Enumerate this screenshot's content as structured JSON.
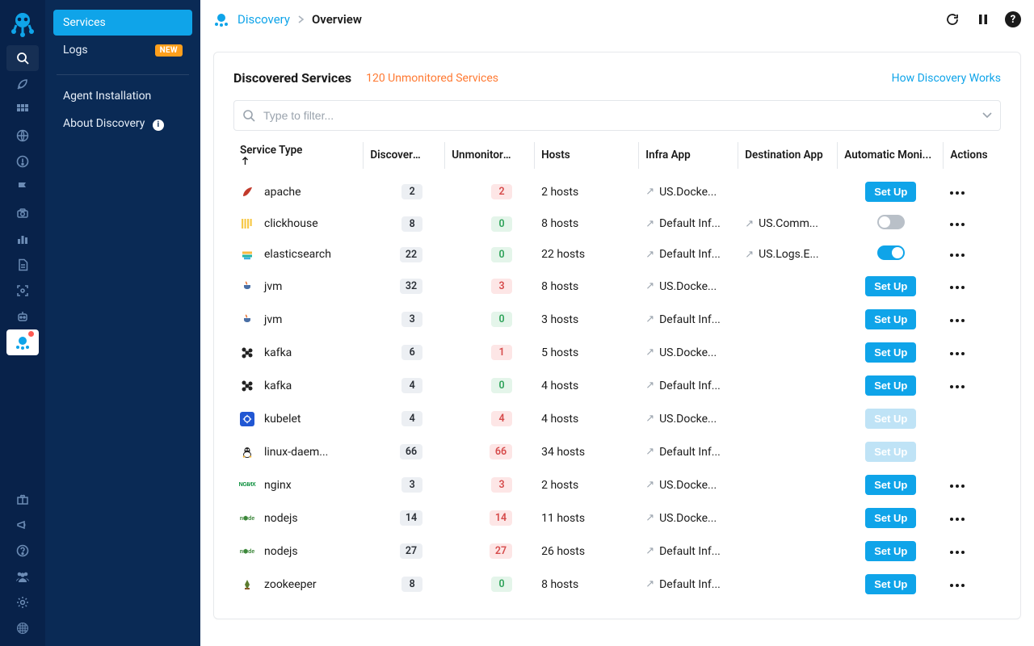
{
  "breadcrumb": {
    "section": "Discovery",
    "page": "Overview"
  },
  "sidebar": {
    "items": [
      {
        "label": "Services",
        "active": true
      },
      {
        "label": "Logs",
        "badge": "NEW"
      }
    ],
    "secondary": [
      {
        "label": "Agent Installation"
      },
      {
        "label": "About Discovery",
        "info": true
      }
    ]
  },
  "head": {
    "title": "Discovered Services",
    "unmonitored_text": "120 Unmonitored Services",
    "how_link": "How Discovery Works"
  },
  "filter": {
    "placeholder": "Type to filter..."
  },
  "columns": {
    "service": "Service Type",
    "discovered": "Discovered",
    "unmonitored": "Unmonitored",
    "hosts": "Hosts",
    "infra": "Infra App",
    "dest": "Destination App",
    "auto": "Automatic Moni...",
    "actions": "Actions"
  },
  "labels": {
    "setup": "Set Up"
  },
  "colors": {
    "accent": "#0fa4e9",
    "warn": "#ff7a33"
  },
  "rows": [
    {
      "svc": "apache",
      "ico": "apache",
      "disc": 2,
      "unm": 2,
      "unmClass": "red",
      "hosts": "2 hosts",
      "infra": "US.Docke...",
      "dest": "",
      "action": "setup"
    },
    {
      "svc": "clickhouse",
      "ico": "clickhouse",
      "disc": 8,
      "unm": 0,
      "unmClass": "green",
      "hosts": "8 hosts",
      "infra": "Default Inf...",
      "dest": "US.Comm...",
      "action": "toggle-off"
    },
    {
      "svc": "elasticsearch",
      "ico": "elastic",
      "disc": 22,
      "unm": 0,
      "unmClass": "green",
      "hosts": "22 hosts",
      "infra": "Default Inf...",
      "dest": "US.Logs.E...",
      "action": "toggle-on"
    },
    {
      "svc": "jvm",
      "ico": "java",
      "disc": 32,
      "unm": 3,
      "unmClass": "red",
      "hosts": "8 hosts",
      "infra": "US.Docke...",
      "dest": "",
      "action": "setup"
    },
    {
      "svc": "jvm",
      "ico": "java",
      "disc": 3,
      "unm": 0,
      "unmClass": "green",
      "hosts": "3 hosts",
      "infra": "Default Inf...",
      "dest": "",
      "action": "setup"
    },
    {
      "svc": "kafka",
      "ico": "kafka",
      "disc": 6,
      "unm": 1,
      "unmClass": "red",
      "hosts": "5 hosts",
      "infra": "US.Docke...",
      "dest": "",
      "action": "setup"
    },
    {
      "svc": "kafka",
      "ico": "kafka",
      "disc": 4,
      "unm": 0,
      "unmClass": "green",
      "hosts": "4 hosts",
      "infra": "Default Inf...",
      "dest": "",
      "action": "setup"
    },
    {
      "svc": "kubelet",
      "ico": "kube",
      "disc": 4,
      "unm": 4,
      "unmClass": "red",
      "hosts": "4 hosts",
      "infra": "US.Docke...",
      "dest": "",
      "action": "setup-disabled"
    },
    {
      "svc": "linux-daem...",
      "ico": "linux",
      "disc": 66,
      "unm": 66,
      "unmClass": "red",
      "hosts": "34 hosts",
      "infra": "Default Inf...",
      "dest": "",
      "action": "setup-disabled"
    },
    {
      "svc": "nginx",
      "ico": "nginx",
      "disc": 3,
      "unm": 3,
      "unmClass": "red",
      "hosts": "2 hosts",
      "infra": "US.Docke...",
      "dest": "",
      "action": "setup"
    },
    {
      "svc": "nodejs",
      "ico": "node",
      "disc": 14,
      "unm": 14,
      "unmClass": "red",
      "hosts": "11 hosts",
      "infra": "US.Docke...",
      "dest": "",
      "action": "setup"
    },
    {
      "svc": "nodejs",
      "ico": "node",
      "disc": 27,
      "unm": 27,
      "unmClass": "red",
      "hosts": "26 hosts",
      "infra": "Default Inf...",
      "dest": "",
      "action": "setup"
    },
    {
      "svc": "zookeeper",
      "ico": "zoo",
      "disc": 8,
      "unm": 0,
      "unmClass": "green",
      "hosts": "8 hosts",
      "infra": "Default Inf...",
      "dest": "",
      "action": "setup"
    }
  ],
  "icons": {
    "apache": {
      "bg": "#ffffff",
      "fg": "#c23a2b",
      "glyph": "feather"
    },
    "clickhouse": {
      "bg": "#ffffff",
      "fg": "#f7c948",
      "glyph": "bars"
    },
    "elastic": {
      "bg": "#ffffff",
      "fg": "#24b4a5",
      "glyph": "stripes"
    },
    "java": {
      "bg": "#ffffff",
      "fg": "#e66f2e",
      "glyph": "cup"
    },
    "kafka": {
      "bg": "#ffffff",
      "fg": "#222",
      "glyph": "graph"
    },
    "kube": {
      "bg": "#2157d3",
      "fg": "#ffffff",
      "glyph": "hex"
    },
    "linux": {
      "bg": "#ffffff",
      "fg": "#222",
      "glyph": "tux"
    },
    "nginx": {
      "bg": "#ffffff",
      "fg": "#0a8f3c",
      "glyph": "nginx"
    },
    "node": {
      "bg": "#ffffff",
      "fg": "#3c873a",
      "glyph": "node"
    },
    "zoo": {
      "bg": "#ffffff",
      "fg": "#5b7b2e",
      "glyph": "leaf"
    }
  }
}
